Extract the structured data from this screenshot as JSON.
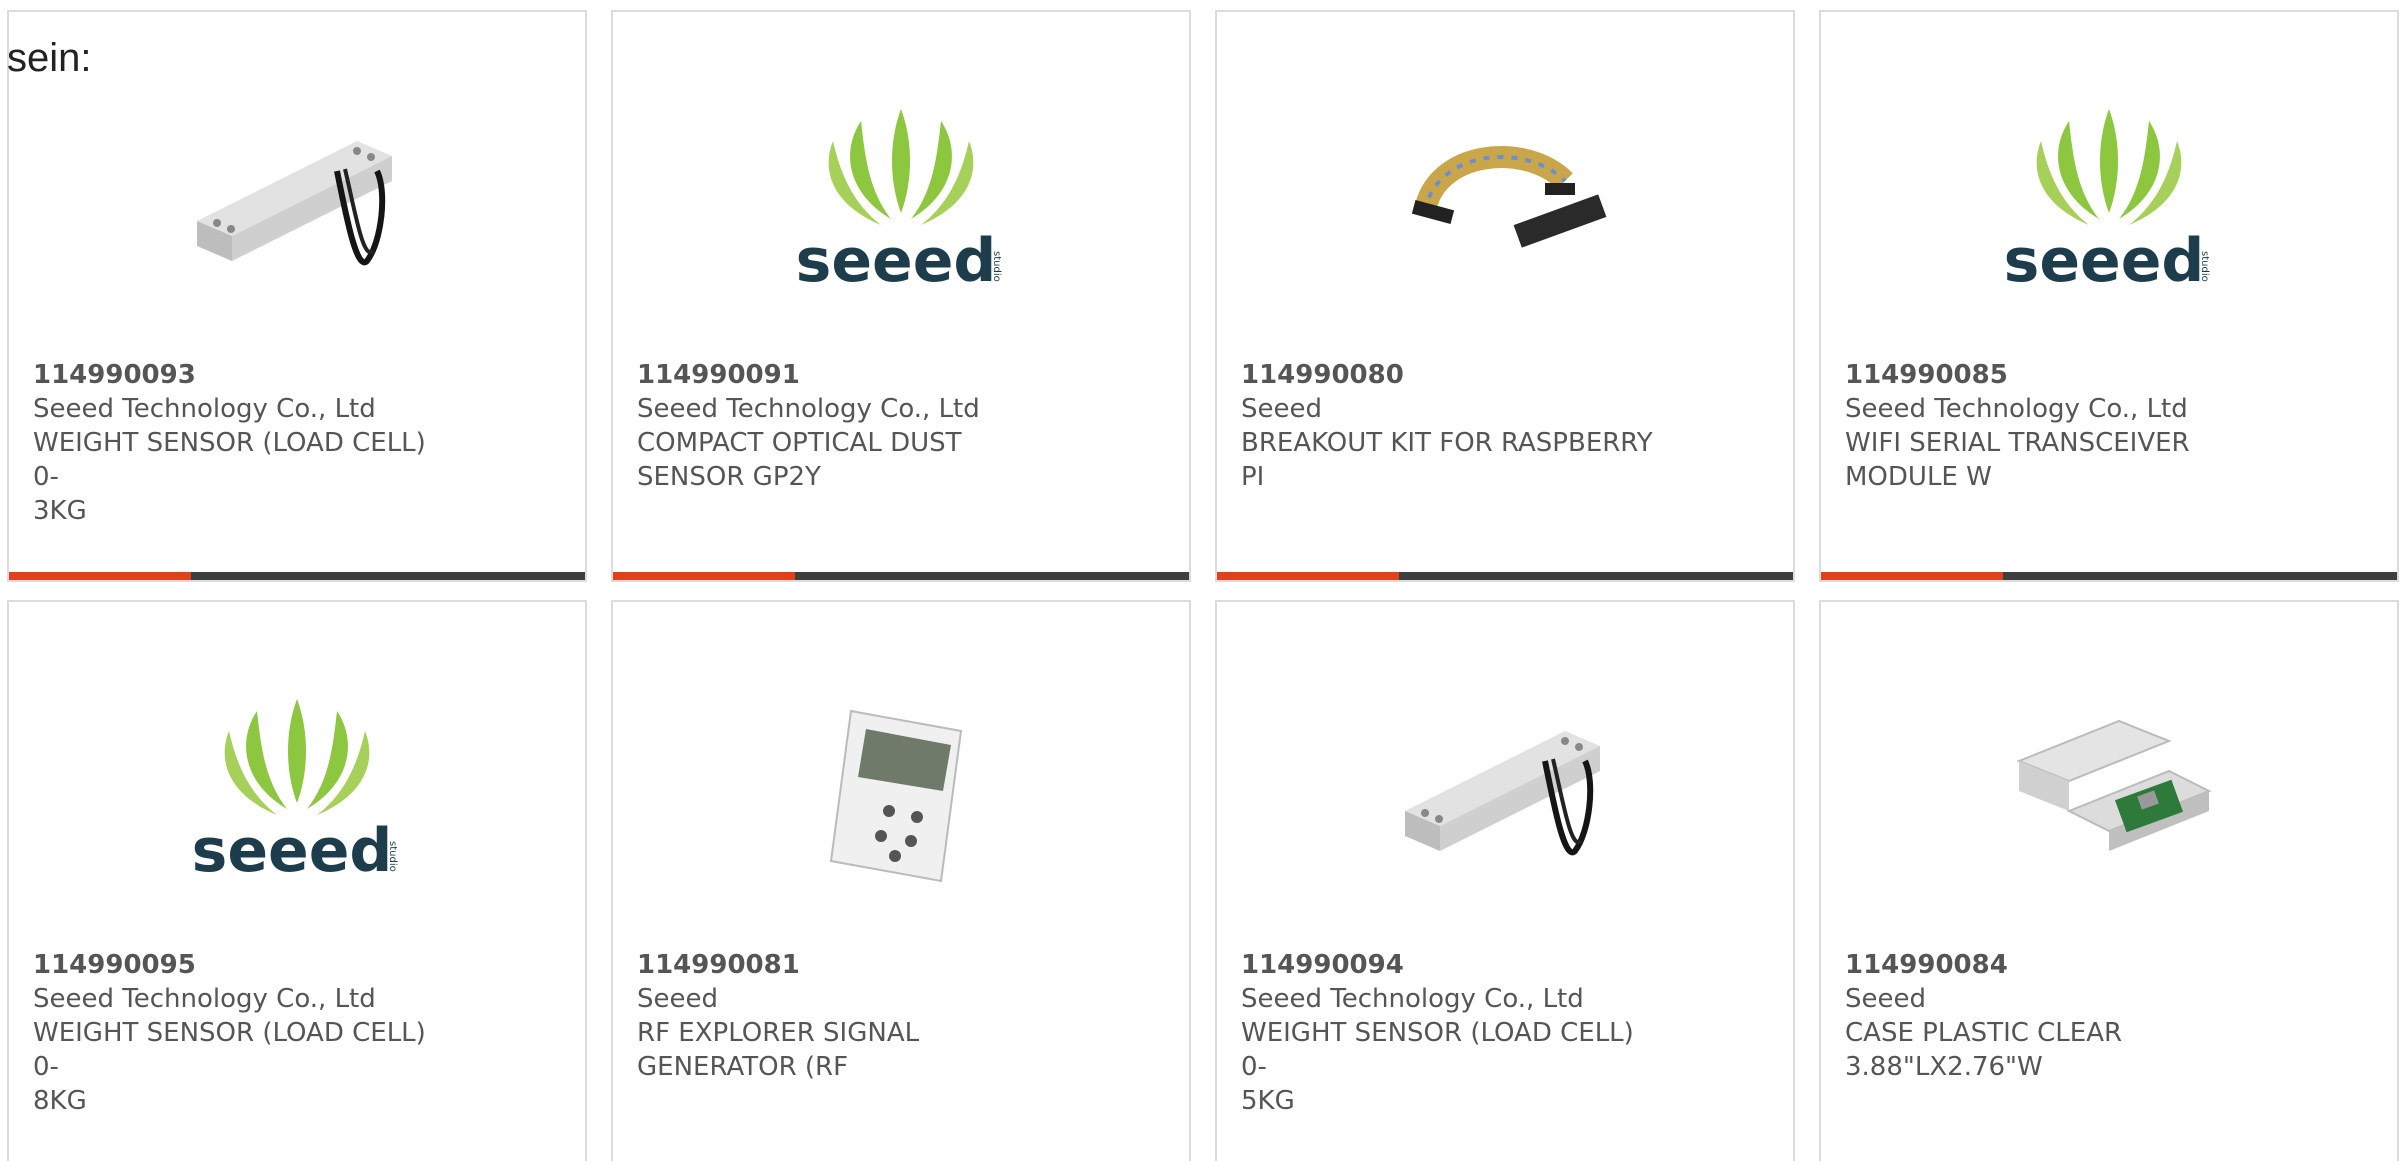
{
  "intro": {
    "text": "sein:"
  },
  "colors": {
    "accent": "#e0401a",
    "bar": "#3f3f3f",
    "seeed_green": "#8dc63f",
    "seeed_navy": "#1d3d4c"
  },
  "products": [
    {
      "sku": "114990093",
      "maker": "Seeed Technology Co., Ltd",
      "desc_line1": "WEIGHT SENSOR (LOAD CELL) 0-",
      "desc_line2": "3KG",
      "image": "load-cell-image"
    },
    {
      "sku": "114990091",
      "maker": "Seeed Technology Co., Ltd",
      "desc_line1": "COMPACT OPTICAL DUST",
      "desc_line2": "SENSOR GP2Y",
      "image": "seeed-logo",
      "logo_text": "seeed",
      "logo_sub": "studio"
    },
    {
      "sku": "114990080",
      "maker": "Seeed",
      "desc_line1": "BREAKOUT KIT FOR RASPBERRY",
      "desc_line2": "PI",
      "image": "ribbon-cable-image"
    },
    {
      "sku": "114990085",
      "maker": "Seeed Technology Co., Ltd",
      "desc_line1": "WIFI SERIAL TRANSCEIVER",
      "desc_line2": "MODULE W",
      "image": "seeed-logo",
      "logo_text": "seeed",
      "logo_sub": "studio"
    },
    {
      "sku": "114990095",
      "maker": "Seeed Technology Co., Ltd",
      "desc_line1": "WEIGHT SENSOR (LOAD CELL) 0-",
      "desc_line2": "8KG",
      "image": "seeed-logo",
      "logo_text": "seeed",
      "logo_sub": "studio"
    },
    {
      "sku": "114990081",
      "maker": "Seeed",
      "desc_line1": "RF EXPLORER SIGNAL",
      "desc_line2": "GENERATOR (RF",
      "image": "handheld-device-image"
    },
    {
      "sku": "114990094",
      "maker": "Seeed Technology Co., Ltd",
      "desc_line1": "WEIGHT SENSOR (LOAD CELL) 0-",
      "desc_line2": "5KG",
      "image": "load-cell-image"
    },
    {
      "sku": "114990084",
      "maker": "Seeed",
      "desc_line1": "CASE PLASTIC CLEAR",
      "desc_line2": "3.88\"LX2.76\"W",
      "image": "plastic-case-image"
    }
  ]
}
